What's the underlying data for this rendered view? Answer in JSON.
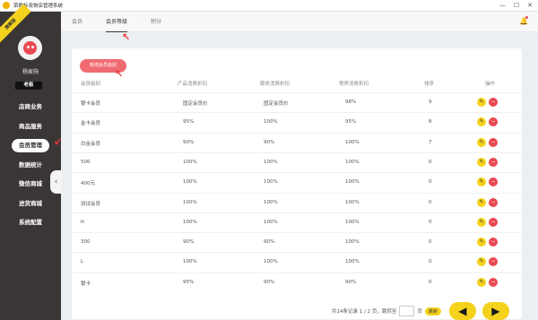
{
  "window": {
    "title": "菜歌标宠物店管理系统"
  },
  "sidebar": {
    "ribbon": "旗舰版",
    "username": "杨家驹",
    "role": "老板",
    "items": [
      {
        "label": "店商业务"
      },
      {
        "label": "商品服务"
      },
      {
        "label": "会员管理"
      },
      {
        "label": "数据统计"
      },
      {
        "label": "微信商城"
      },
      {
        "label": "进货商城"
      },
      {
        "label": "系统配置"
      }
    ]
  },
  "tabs": [
    {
      "label": "会员"
    },
    {
      "label": "会员等级"
    },
    {
      "label": "积分"
    }
  ],
  "main": {
    "add_button": "新增会员级别",
    "headers": [
      "会员级别",
      "产品消费折扣",
      "服务消费折扣",
      "寄养消费折扣",
      "排序",
      "操作"
    ],
    "rows": [
      [
        "银卡会员",
        "固定会员价",
        "固定会员价",
        "98%",
        "9"
      ],
      [
        "金卡会员",
        "95%",
        "100%",
        "95%",
        "8"
      ],
      [
        "白金会员",
        "90%",
        "90%",
        "100%",
        "7"
      ],
      [
        "500",
        "100%",
        "100%",
        "100%",
        "0"
      ],
      [
        "400元",
        "100%",
        "100%",
        "100%",
        "0"
      ],
      [
        "测试会员",
        "100%",
        "100%",
        "100%",
        "0"
      ],
      [
        "tt",
        "100%",
        "100%",
        "100%",
        "0"
      ],
      [
        "300",
        "90%",
        "90%",
        "100%",
        "0"
      ],
      [
        "L",
        "100%",
        "100%",
        "100%",
        "0"
      ],
      [
        "银卡",
        "95%",
        "90%",
        "90%",
        "0"
      ]
    ],
    "pagination": {
      "summary": "共14条记录 1 / 2 页，跳转至",
      "page_suffix": "页",
      "go": "跳转",
      "prev": "◀",
      "next": "▶"
    }
  },
  "colors": {
    "accent_yellow": "#f5d21c",
    "accent_red": "#e84a52",
    "sidebar_bg": "#3a3635"
  }
}
